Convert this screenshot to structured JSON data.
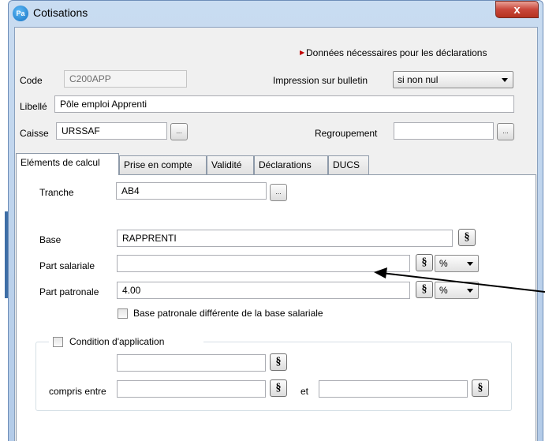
{
  "window": {
    "title": "Cotisations",
    "app_icon": "Pa",
    "close": "x"
  },
  "notice": "Données nécessaires pour les déclarations",
  "header": {
    "code_label": "Code",
    "code_value": "C200APP",
    "impression_label": "Impression sur bulletin",
    "impression_value": "si non nul",
    "libelle_label": "Libellé",
    "libelle_value": "Pôle emploi Apprenti",
    "caisse_label": "Caisse",
    "caisse_value": "URSSAF",
    "regroupement_label": "Regroupement",
    "regroupement_value": "",
    "dots": "..."
  },
  "tabs": [
    "Eléments de calcul",
    "Prise en compte",
    "Validité",
    "Déclarations",
    "DUCS"
  ],
  "calc": {
    "tranche_label": "Tranche",
    "tranche_value": "AB4",
    "base_label": "Base",
    "base_value": "RAPPRENTI",
    "part_salariale_label": "Part salariale",
    "part_salariale_value": "",
    "part_salariale_unit": "%",
    "part_patronale_label": "Part patronale",
    "part_patronale_value": "4.00",
    "part_patronale_unit": "%",
    "base_patronale_diff_label": "Base patronale différente de la base salariale",
    "section_symbol": "§"
  },
  "condition": {
    "label": "Condition d'application",
    "value": "",
    "compris_entre_label": "compris entre",
    "from_value": "",
    "et_label": "et",
    "to_value": ""
  },
  "colors": {
    "notice_marker": "#c00000",
    "frame": "#b3cbe8",
    "close": "#c9473a"
  }
}
